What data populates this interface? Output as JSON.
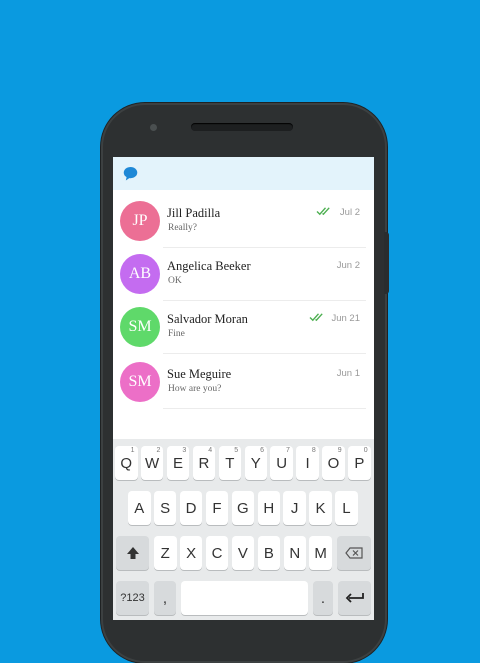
{
  "colors": {
    "background": "#0a9ae0",
    "app_bar": "#e3f3fb",
    "tick_green": "#4caf50",
    "logo_blue": "#1e88d6"
  },
  "app": {
    "logo_icon": "chat-bubble-icon"
  },
  "conversations": [
    {
      "initials": "JP",
      "name": "Jill   Padilla",
      "message": "Really?",
      "date": "Jul 2",
      "read": true,
      "color": "#ec6f95"
    },
    {
      "initials": "AB",
      "name": "Angelica Beeker",
      "message": "OK",
      "date": "Jun 2",
      "read": false,
      "color": "#c46cf0"
    },
    {
      "initials": "SM",
      "name": "Salvador Moran",
      "message": "Fine",
      "date": "Jun 21",
      "read": true,
      "color": "#5fd96a"
    },
    {
      "initials": "SM",
      "name": "Sue  Meguire",
      "message": "How are you?",
      "date": "Jun 1",
      "read": false,
      "color": "#ec6fc7"
    }
  ],
  "keyboard": {
    "row1": [
      {
        "label": "Q",
        "hint": "1"
      },
      {
        "label": "W",
        "hint": "2"
      },
      {
        "label": "E",
        "hint": "3"
      },
      {
        "label": "R",
        "hint": "4"
      },
      {
        "label": "T",
        "hint": "5"
      },
      {
        "label": "Y",
        "hint": "6"
      },
      {
        "label": "U",
        "hint": "7"
      },
      {
        "label": "I",
        "hint": "8"
      },
      {
        "label": "O",
        "hint": "9"
      },
      {
        "label": "P",
        "hint": "0"
      }
    ],
    "row2": [
      "A",
      "S",
      "D",
      "F",
      "G",
      "H",
      "J",
      "K",
      "L"
    ],
    "row3": [
      "Z",
      "X",
      "C",
      "V",
      "B",
      "N",
      "M"
    ],
    "shift_icon": "shift-icon",
    "backspace_icon": "backspace-icon",
    "symbols_label": "?123",
    "comma_label": ",",
    "period_label": ".",
    "enter_icon": "enter-icon"
  }
}
